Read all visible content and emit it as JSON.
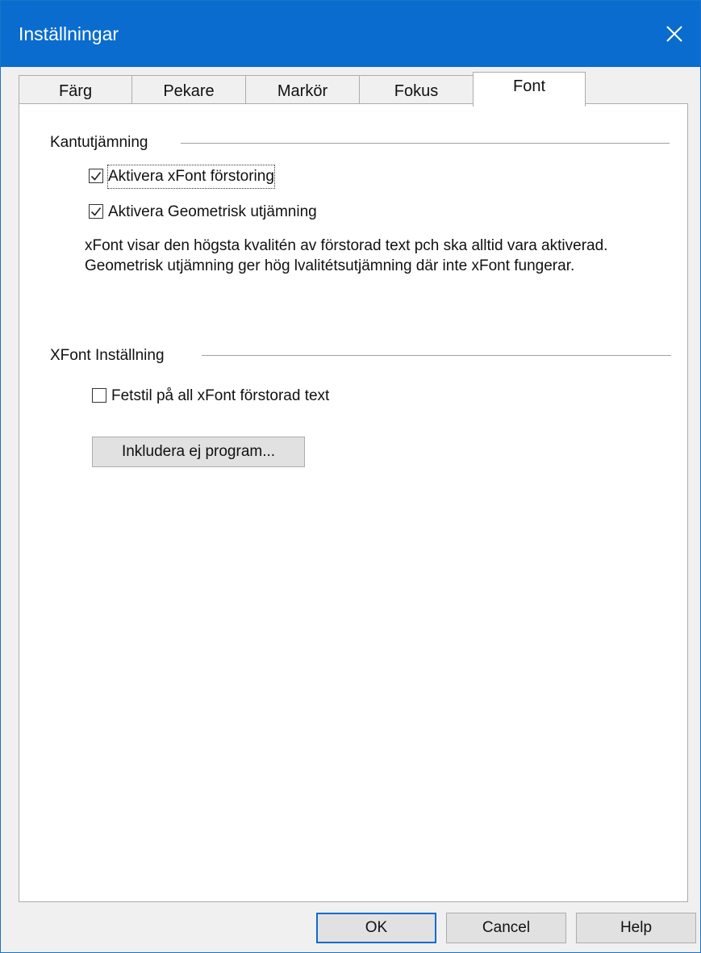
{
  "window": {
    "title": "Inställningar",
    "close_glyph": "×",
    "colors": {
      "titlebar": "#0a6ccf",
      "window_bg": "#f0f0f0",
      "panel_bg": "#ffffff",
      "button_bg": "#e1e1e1",
      "default_button_border": "#0a6ccf"
    }
  },
  "tabs": [
    {
      "label": "Färg",
      "active": false
    },
    {
      "label": "Pekare",
      "active": false
    },
    {
      "label": "Markör",
      "active": false
    },
    {
      "label": "Fokus",
      "active": false
    },
    {
      "label": "Font",
      "active": true
    }
  ],
  "antialias": {
    "heading": "Kantutjämning",
    "xfont_checkbox": {
      "label": "Aktivera xFont förstoring",
      "checked": true
    },
    "geometric_checkbox": {
      "label": "Aktivera Geometrisk utjämning",
      "checked": true
    },
    "description": "xFont visar den högsta kvalitén av förstorad text pch ska alltid vara aktiverad. Geometrisk utjämning ger hög lvalitétsutjämning där inte xFont fungerar."
  },
  "xfont_settings": {
    "heading": "XFont Inställning",
    "bold_checkbox": {
      "label": "Fetstil på all xFont förstorad text",
      "checked": false
    },
    "exclude_button": "Inkludera ej program..."
  },
  "footer": {
    "ok": "OK",
    "cancel": "Cancel",
    "help": "Help"
  },
  "icons": {
    "close": "close-icon",
    "check": "checkmark-icon"
  }
}
